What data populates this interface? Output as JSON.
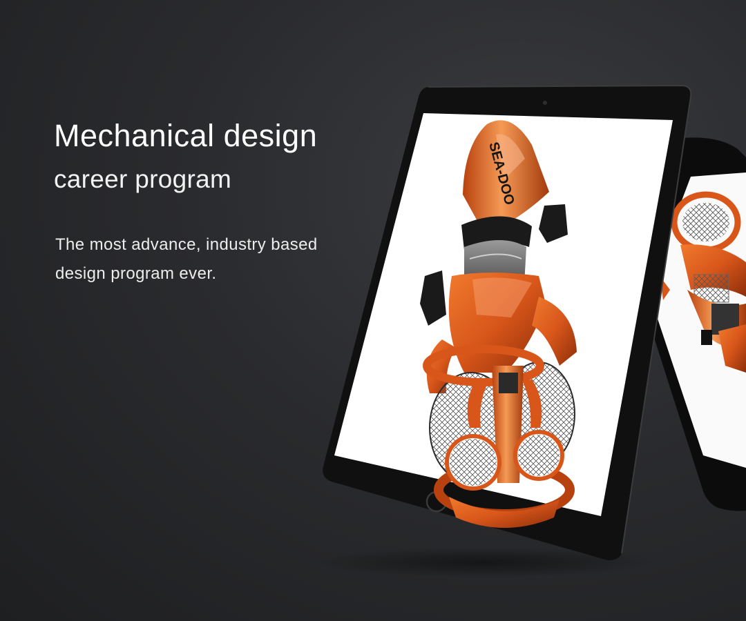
{
  "hero": {
    "headline": "Mechanical design",
    "subheadline": "career program",
    "description_line1": "The most advance, industry based",
    "description_line2": "design program ever."
  },
  "colors": {
    "background": "#2a2b2e",
    "accent": "#e2631b",
    "text": "#ffffff"
  },
  "devices": {
    "front": "tablet",
    "back": "phone",
    "screen_image": "exploded-orange-underwater-scooter-render",
    "brand_mark": "SEA-DOO"
  }
}
